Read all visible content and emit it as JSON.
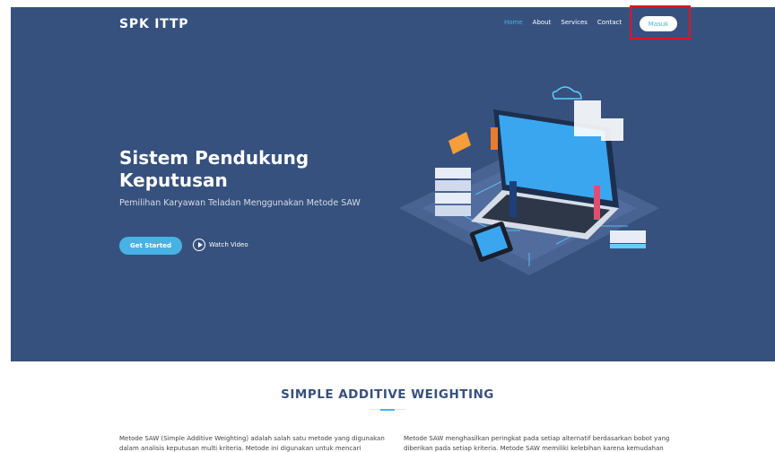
{
  "header": {
    "brand": "SPK ITTP",
    "nav": [
      "Home",
      "About",
      "Services",
      "Contact"
    ],
    "login_label": "Masuk"
  },
  "hero": {
    "title": "Sistem Pendukung Keputusan",
    "subtitle": "Pemilihan Karyawan Teladan Menggunakan Metode SAW",
    "cta_label": "Get Started",
    "video_label": "Watch Video"
  },
  "section": {
    "title": "SIMPLE ADDITIVE WEIGHTING",
    "left_line1": "Metode SAW (Simple Additive Weighting) adalah salah satu metode yang digunakan",
    "left_line2": "dalam analisis keputusan multi kriteria. Metode ini digunakan untuk mencari",
    "right_line1": "Metode SAW menghasilkan peringkat pada setiap alternatif berdasarkan bobot yang",
    "right_line2": "diberikan pada setiap kriteria. Metode SAW memiliki kelebihan karena kemudahan"
  },
  "colors": {
    "hero_bg": "#37517e",
    "accent": "#47b2e4",
    "highlight_box": "#e0141e"
  },
  "icons": [
    "play-icon"
  ]
}
